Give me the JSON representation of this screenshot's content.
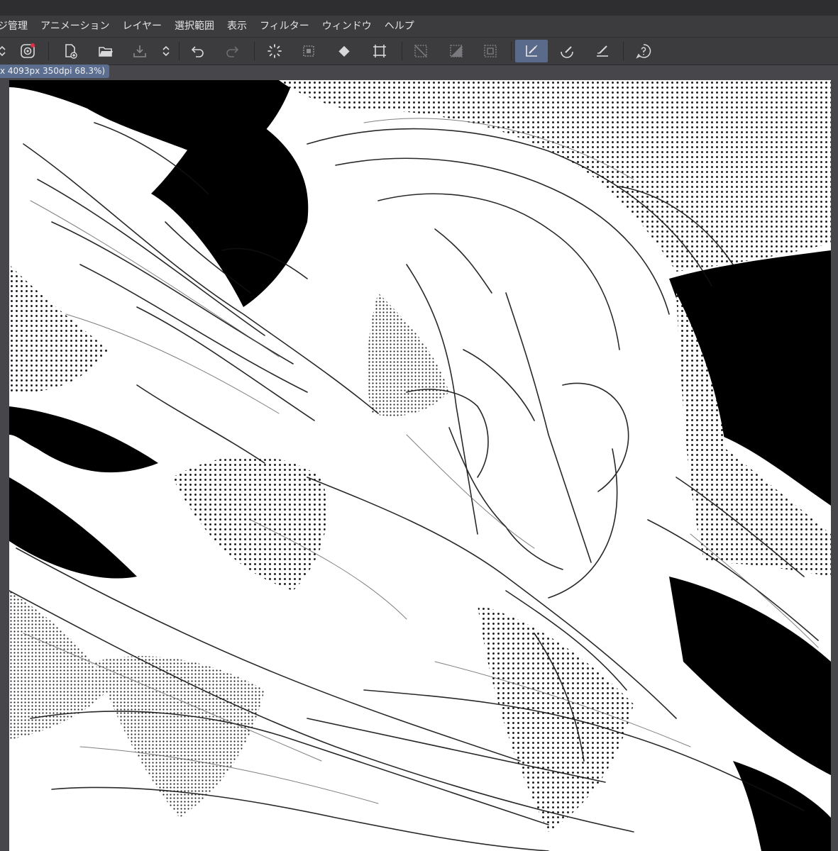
{
  "menubar": {
    "items": [
      "ジ管理",
      "アニメーション",
      "レイヤー",
      "選択範囲",
      "表示",
      "フィルター",
      "ウィンドウ",
      "ヘルプ"
    ]
  },
  "toolbar": {
    "buttons": [
      {
        "name": "stepper-icon",
        "active": false
      },
      {
        "name": "cloud-sync-icon",
        "active": false
      },
      {
        "name": "new-file-icon",
        "active": false
      },
      {
        "name": "open-folder-icon",
        "active": false
      },
      {
        "name": "save-icon",
        "active": false
      },
      {
        "name": "stepper-icon",
        "active": false
      },
      {
        "name": "undo-icon",
        "active": false
      },
      {
        "name": "redo-icon",
        "active": false
      },
      {
        "name": "loading-icon",
        "active": false
      },
      {
        "name": "clear-icon",
        "active": false
      },
      {
        "name": "fill-icon",
        "active": false
      },
      {
        "name": "transform-icon",
        "active": false
      },
      {
        "name": "deselect-icon",
        "active": false
      },
      {
        "name": "invert-selection-icon",
        "active": false
      },
      {
        "name": "selection-border-icon",
        "active": false
      },
      {
        "name": "snap-ruler-icon",
        "active": true
      },
      {
        "name": "snap-special-ruler-icon",
        "active": false
      },
      {
        "name": "snap-grid-icon",
        "active": false
      },
      {
        "name": "help-icon",
        "active": false
      }
    ]
  },
  "document": {
    "tab_label": "x 4093px 350dpi 68.3%)"
  },
  "colors": {
    "accent": "#5c6e90",
    "active_tool": "#5a6a8a",
    "menubar_bg": "#3c3c3f",
    "canvas_bg": "#47474b"
  }
}
